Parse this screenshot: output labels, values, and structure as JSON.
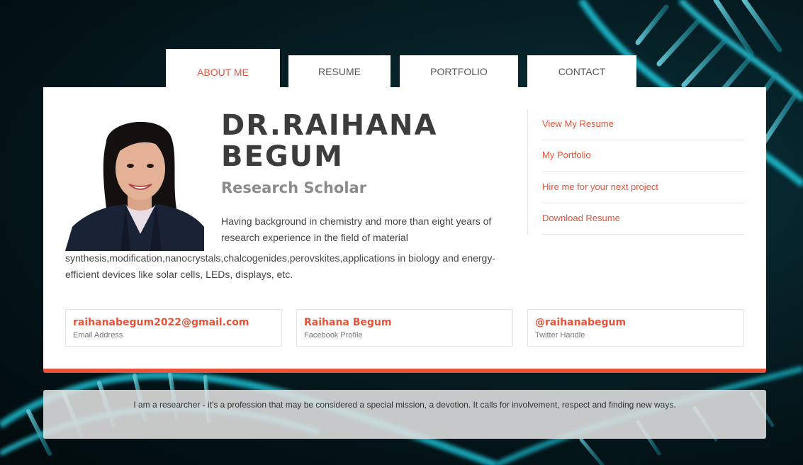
{
  "tabs": [
    {
      "label": "ABOUT ME",
      "active": true
    },
    {
      "label": "RESUME",
      "active": false
    },
    {
      "label": "PORTFOLIO",
      "active": false
    },
    {
      "label": "CONTACT",
      "active": false
    }
  ],
  "profile": {
    "name_line1": "DR.RAIHANA",
    "name_line2": "BEGUM",
    "title": "Research Scholar",
    "bio_part1": "Having background in chemistry and more than eight years of research experience in the field of material",
    "bio_part2": "synthesis,modification,nanocrystals,chalcogenides,perovskites,applications in biology and energy- efficient devices like solar cells, LEDs, displays, etc."
  },
  "side_links": [
    "View My Resume",
    "My Portfolio",
    "Hire me for your next project",
    "Download Resume"
  ],
  "contacts": [
    {
      "value": "raihanabegum2022@gmail.com",
      "label": "Email Address"
    },
    {
      "value": "Raihana Begum",
      "label": "Facebook Profile"
    },
    {
      "value": "@raihanabegum",
      "label": "Twitter Handle"
    }
  ],
  "quote": "I am a researcher - it's a profession that may be considered a special mission, a devotion. It calls for involvement, respect and finding new ways.",
  "colors": {
    "accent": "#e8533a",
    "heading": "#3c3c3c",
    "subtitle": "#8a8a8a",
    "background": "#062229",
    "dna_glow": "#29d3e6"
  }
}
